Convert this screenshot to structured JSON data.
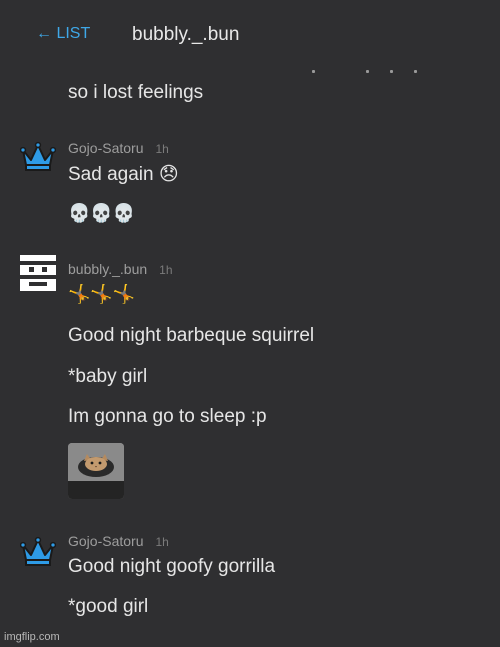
{
  "header": {
    "back_label": "← LIST",
    "title": "bubbly._.bun"
  },
  "messages": {
    "m0": "so i lost feelings",
    "m1_author": "Gojo-Satoru",
    "m1_time": "1h",
    "m1_text": "Sad again",
    "m1_emoji": "😞",
    "m1_skulls": "💀💀💀",
    "m2_author": "bubbly._.bun",
    "m2_time": "1h",
    "m2_cartwheels": "🤸🤸🤸",
    "m2_text1": "Good night barbeque squirrel",
    "m2_text2": "*baby girl",
    "m2_text3": "Im gonna go to sleep :p",
    "m3_author": "Gojo-Satoru",
    "m3_time": "1h",
    "m3_text1": "Good night goofy gorrilla",
    "m3_text2": "*good girl"
  },
  "icons": {
    "crown": "crown-icon",
    "pixel_avatar": "pixel-face-icon",
    "cat_image": "cat-thumbnail"
  },
  "colors": {
    "background": "#2f2f31",
    "link": "#3fa8e8",
    "crown": "#2e9be6"
  },
  "watermark": "imgflip.com"
}
